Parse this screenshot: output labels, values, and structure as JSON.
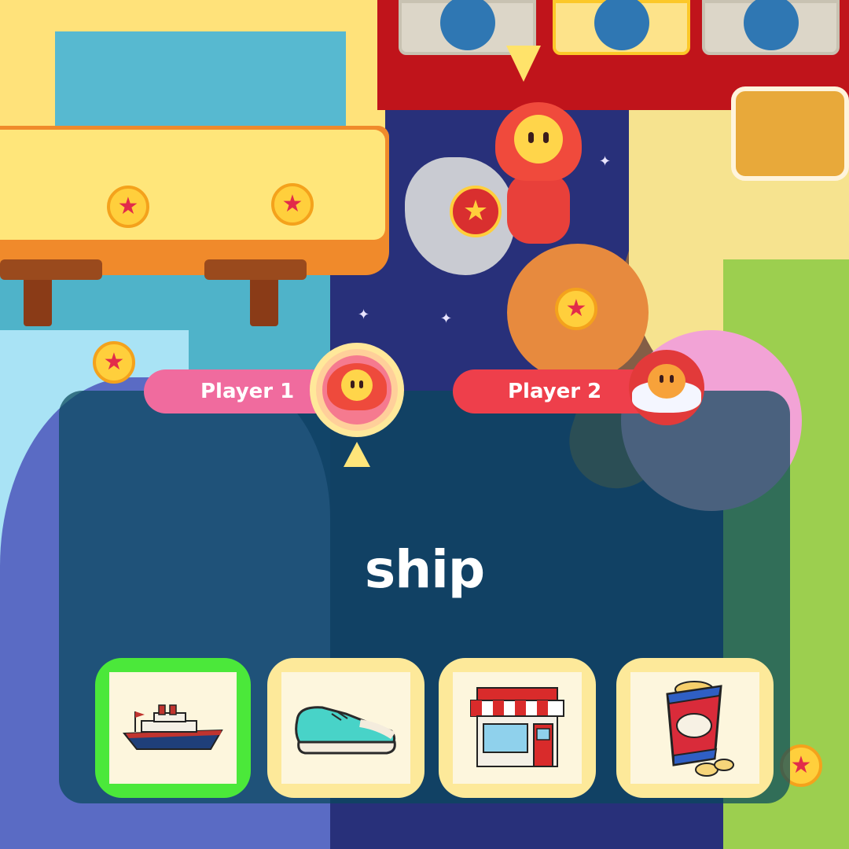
{
  "players": [
    {
      "label": "Player 1"
    },
    {
      "label": "Player 2"
    }
  ],
  "prompt_word": "ship",
  "choices": [
    {
      "id": "ship",
      "icon": "ship-icon",
      "state": "correct-highlighted"
    },
    {
      "id": "shoe",
      "icon": "sneaker-icon",
      "state": "default"
    },
    {
      "id": "shop",
      "icon": "storefront-icon",
      "state": "default"
    },
    {
      "id": "chips",
      "icon": "chips-bag-icon",
      "state": "default"
    }
  ],
  "colors": {
    "correct_highlight": "#4be83a",
    "choice_frame": "#fde99a",
    "player1_pill": "#f06b9e",
    "player2_pill": "#ee3f4b",
    "panel_overlay": "#08485c"
  }
}
